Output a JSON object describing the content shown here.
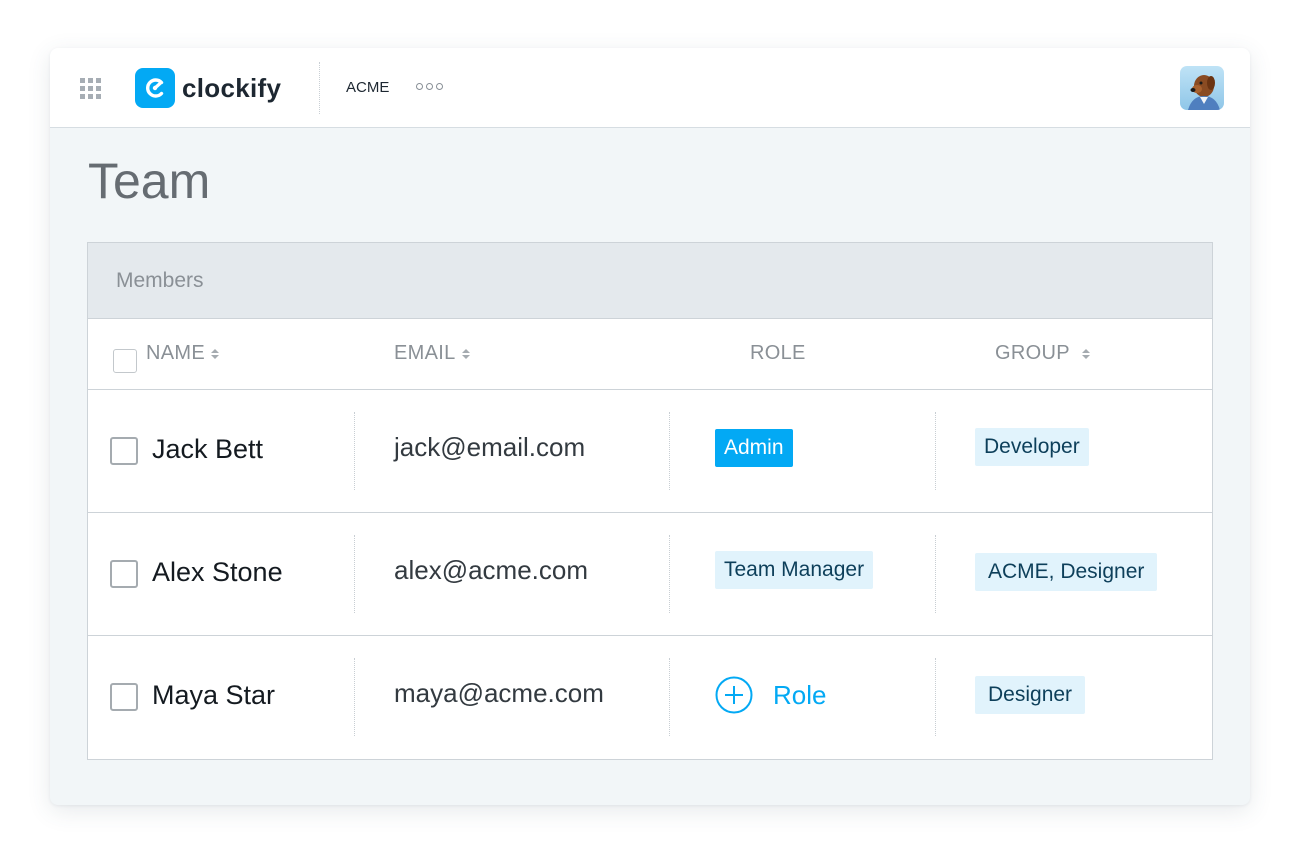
{
  "header": {
    "logo_text": "clockify",
    "workspace": "ACME",
    "apps_icon": "grid-icon",
    "more_icon": "more-horizontal-icon",
    "avatar_icon": "user-avatar"
  },
  "page": {
    "title": "Team"
  },
  "members": {
    "card_title": "Members",
    "columns": {
      "name": "NAME",
      "email": "EMAIL",
      "role": "ROLE",
      "group": "GROUP"
    },
    "rows": [
      {
        "name": "Jack Bett",
        "email": "jack@email.com",
        "role": "Admin",
        "group": "Developer"
      },
      {
        "name": "Alex Stone",
        "email": "alex@acme.com",
        "role": "Team Manager",
        "group": "ACME, Designer"
      },
      {
        "name": "Maya Star",
        "email": "maya@acme.com",
        "role": "",
        "group": "Designer",
        "add_role_label": "Role"
      }
    ]
  },
  "colors": {
    "brand": "#03a9f4",
    "tag_light_bg": "#e1f3fc",
    "page_bg": "#f2f6f8"
  }
}
